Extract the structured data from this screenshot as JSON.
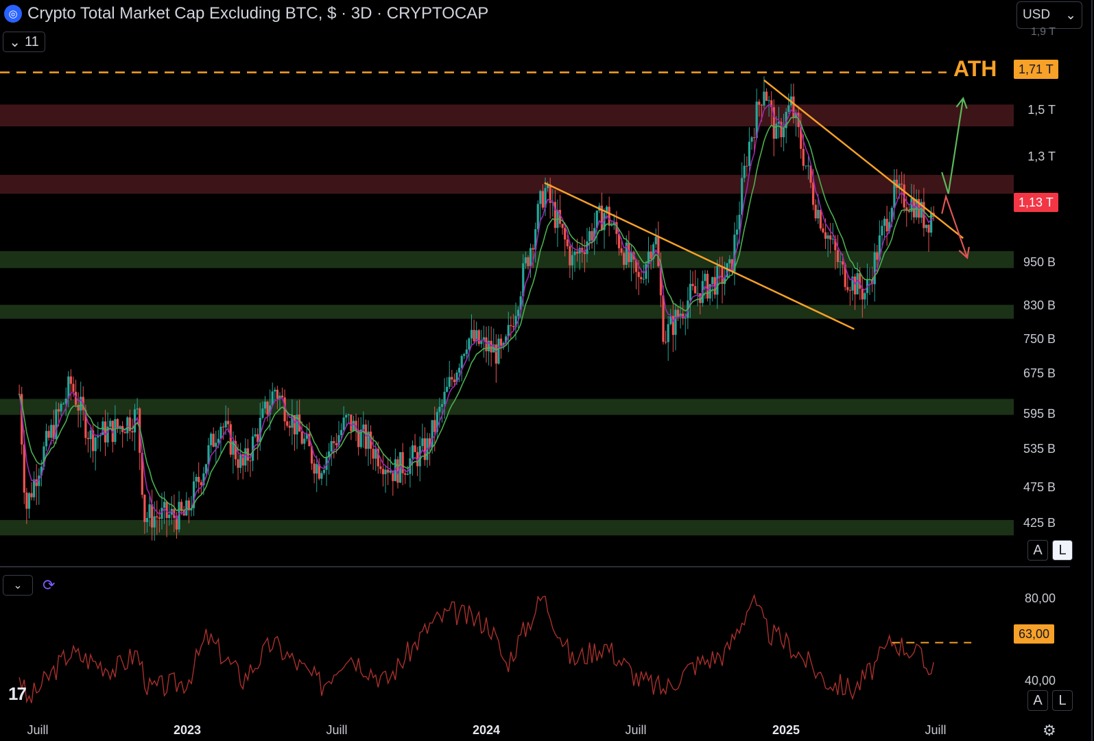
{
  "header": {
    "title": "Crypto Total Market Cap Excluding BTC, $ · 3D · CRYPTOCAP",
    "indicator_count": "11",
    "currency": "USD"
  },
  "price_axis": {
    "labels": [
      "1,5 T",
      "1,3 T",
      "950 B",
      "830 B",
      "750 B",
      "675 B",
      "595 B",
      "535 B",
      "475 B",
      "425 B"
    ],
    "partial_top": "1,9 T",
    "last_price_badge": "1,13 T",
    "ath_badge": "1,71 T",
    "ath_text": "ATH",
    "scale_buttons": [
      "A",
      "L"
    ]
  },
  "oscillator_axis": {
    "labels": [
      "80,00",
      "40,00"
    ],
    "level_badge": "63,00",
    "scale_buttons": [
      "A",
      "L"
    ]
  },
  "time_axis": [
    "Juill",
    "2023",
    "Juill",
    "2024",
    "Juill",
    "2025",
    "Juill"
  ],
  "colors": {
    "up": "#26a69a",
    "down": "#ef5350",
    "ema_fast": "#9c27b0",
    "ema_slow": "#4caf50",
    "trendline": "#f7a128",
    "ath": "#f7a128",
    "resistance_zone": "#3d1518",
    "support_zone": "#1b3217",
    "oscillator": "#a8302c",
    "arrow_up": "#5cb85c",
    "arrow_down": "#e05555"
  },
  "chart_data": [
    {
      "type": "candlestick",
      "title": "Crypto Total Market Cap Excluding BTC, $ · 3D · CRYPTOCAP",
      "scale": "log",
      "ylim": [
        380000000000,
        1950000000000
      ],
      "anchors": [
        {
          "x": "2022-06-10",
          "y": 640000000000
        },
        {
          "x": "2022-06-18",
          "y": 450000000000
        },
        {
          "x": "2022-07-05",
          "y": 520000000000
        },
        {
          "x": "2022-08-12",
          "y": 660000000000
        },
        {
          "x": "2022-09-05",
          "y": 560000000000
        },
        {
          "x": "2022-10-05",
          "y": 575000000000
        },
        {
          "x": "2022-11-01",
          "y": 600000000000
        },
        {
          "x": "2022-11-10",
          "y": 440000000000
        },
        {
          "x": "2022-12-30",
          "y": 440000000000
        },
        {
          "x": "2023-02-10",
          "y": 590000000000
        },
        {
          "x": "2023-03-10",
          "y": 510000000000
        },
        {
          "x": "2023-04-18",
          "y": 650000000000
        },
        {
          "x": "2023-06-10",
          "y": 510000000000
        },
        {
          "x": "2023-07-15",
          "y": 590000000000
        },
        {
          "x": "2023-09-10",
          "y": 505000000000
        },
        {
          "x": "2023-10-20",
          "y": 540000000000
        },
        {
          "x": "2023-12-08",
          "y": 760000000000
        },
        {
          "x": "2024-01-22",
          "y": 720000000000
        },
        {
          "x": "2024-03-12",
          "y": 1200000000000
        },
        {
          "x": "2024-04-15",
          "y": 960000000000
        },
        {
          "x": "2024-05-25",
          "y": 1120000000000
        },
        {
          "x": "2024-07-05",
          "y": 900000000000
        },
        {
          "x": "2024-07-25",
          "y": 1050000000000
        },
        {
          "x": "2024-08-05",
          "y": 760000000000
        },
        {
          "x": "2024-09-05",
          "y": 860000000000
        },
        {
          "x": "2024-10-25",
          "y": 930000000000
        },
        {
          "x": "2024-11-15",
          "y": 1350000000000
        },
        {
          "x": "2024-12-05",
          "y": 1650000000000
        },
        {
          "x": "2024-12-20",
          "y": 1400000000000
        },
        {
          "x": "2025-01-07",
          "y": 1550000000000
        },
        {
          "x": "2025-02-05",
          "y": 1150000000000
        },
        {
          "x": "2025-03-10",
          "y": 930000000000
        },
        {
          "x": "2025-04-08",
          "y": 870000000000
        },
        {
          "x": "2025-05-12",
          "y": 1180000000000
        },
        {
          "x": "2025-06-05",
          "y": 1150000000000
        },
        {
          "x": "2025-06-22",
          "y": 1080000000000
        },
        {
          "x": "2025-06-30",
          "y": 1130000000000
        }
      ],
      "zones": [
        {
          "kind": "resistance",
          "y": [
            1450000000000,
            1550000000000
          ]
        },
        {
          "kind": "resistance",
          "y": [
            1180000000000,
            1250000000000
          ]
        },
        {
          "kind": "support",
          "y": [
            940000000000,
            990000000000
          ]
        },
        {
          "kind": "support",
          "y": [
            805000000000,
            840000000000
          ]
        },
        {
          "kind": "support",
          "y": [
            600000000000,
            630000000000
          ]
        },
        {
          "kind": "support",
          "y": [
            415000000000,
            435000000000
          ]
        }
      ],
      "ath_level": 1710000000000,
      "last_price": 1130000000000,
      "trendlines": [
        {
          "from": {
            "x": "2024-03-12",
            "y": 1220000000000
          },
          "to": {
            "x": "2025-03-25",
            "y": 780000000000
          }
        },
        {
          "from": {
            "x": "2024-12-05",
            "y": 1670000000000
          },
          "to": {
            "x": "2025-08-05",
            "y": 1030000000000
          }
        }
      ],
      "annotations": [
        {
          "kind": "arrow-up",
          "path": [
            {
              "x": "2025-07-10",
              "y": 1260000000000
            },
            {
              "x": "2025-07-18",
              "y": 1180000000000
            },
            {
              "x": "2025-08-05",
              "y": 1580000000000
            }
          ]
        },
        {
          "kind": "arrow-down",
          "path": [
            {
              "x": "2025-07-10",
              "y": 1110000000000
            },
            {
              "x": "2025-07-15",
              "y": 1170000000000
            },
            {
              "x": "2025-08-10",
              "y": 970000000000
            }
          ]
        }
      ]
    },
    {
      "type": "line",
      "ylim": [
        28,
        92
      ],
      "anchors": [
        {
          "x": "2022-06-10",
          "y": 48
        },
        {
          "x": "2022-06-20",
          "y": 34
        },
        {
          "x": "2022-08-10",
          "y": 58
        },
        {
          "x": "2022-10-05",
          "y": 50
        },
        {
          "x": "2022-11-01",
          "y": 58
        },
        {
          "x": "2022-11-15",
          "y": 40
        },
        {
          "x": "2023-01-01",
          "y": 44
        },
        {
          "x": "2023-01-25",
          "y": 66
        },
        {
          "x": "2023-03-10",
          "y": 45
        },
        {
          "x": "2023-04-15",
          "y": 63
        },
        {
          "x": "2023-06-15",
          "y": 42
        },
        {
          "x": "2023-07-15",
          "y": 58
        },
        {
          "x": "2023-09-01",
          "y": 44
        },
        {
          "x": "2023-10-25",
          "y": 72
        },
        {
          "x": "2023-11-20",
          "y": 78
        },
        {
          "x": "2024-01-05",
          "y": 72
        },
        {
          "x": "2024-01-25",
          "y": 52
        },
        {
          "x": "2024-03-10",
          "y": 86
        },
        {
          "x": "2024-04-15",
          "y": 54
        },
        {
          "x": "2024-05-25",
          "y": 62
        },
        {
          "x": "2024-07-05",
          "y": 45
        },
        {
          "x": "2024-08-05",
          "y": 40
        },
        {
          "x": "2024-09-10",
          "y": 52
        },
        {
          "x": "2024-10-20",
          "y": 58
        },
        {
          "x": "2024-11-20",
          "y": 84
        },
        {
          "x": "2024-12-10",
          "y": 68
        },
        {
          "x": "2025-01-05",
          "y": 62
        },
        {
          "x": "2025-02-20",
          "y": 44
        },
        {
          "x": "2025-03-25",
          "y": 40
        },
        {
          "x": "2025-04-20",
          "y": 52
        },
        {
          "x": "2025-05-10",
          "y": 64
        },
        {
          "x": "2025-06-10",
          "y": 58
        },
        {
          "x": "2025-06-22",
          "y": 50
        },
        {
          "x": "2025-07-01",
          "y": 55
        }
      ],
      "level": 63,
      "level_line": {
        "from": "2025-05-10",
        "to": "2025-08-15"
      }
    }
  ]
}
